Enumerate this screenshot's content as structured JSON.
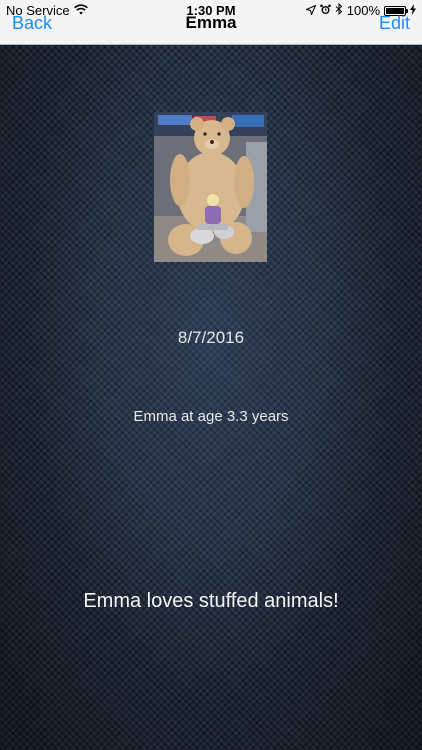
{
  "status_bar": {
    "carrier": "No Service",
    "time": "1:30 PM",
    "battery_percent": "100%",
    "battery_level": 1.0,
    "icons": [
      "wifi-icon",
      "location-icon",
      "alarm-icon",
      "bluetooth-icon",
      "battery-icon",
      "charging-icon"
    ]
  },
  "nav": {
    "back_label": "Back",
    "title": "Emma",
    "edit_label": "Edit"
  },
  "entry": {
    "date": "8/7/2016",
    "age_caption": "Emma at age 3.3 years",
    "note": "Emma loves stuffed animals!"
  },
  "colors": {
    "accent": "#1a8cff",
    "background": "#1f2c3f",
    "nav_background": "#f4f4f5"
  }
}
